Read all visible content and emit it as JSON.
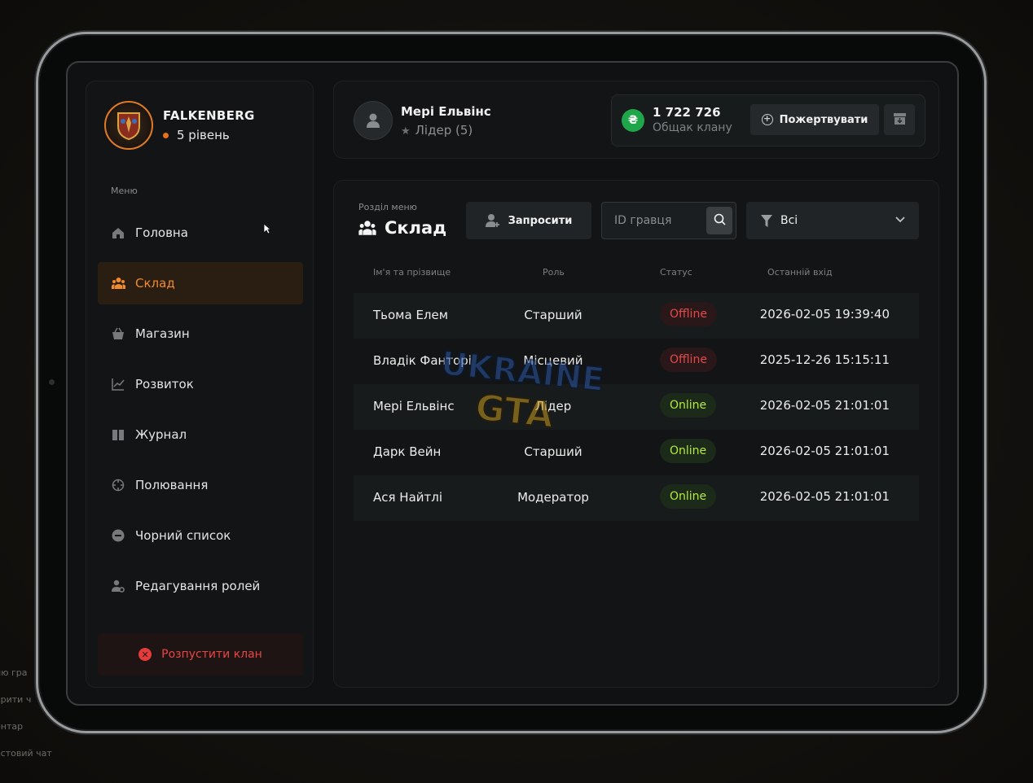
{
  "background": {
    "lines": [
      "ню гра",
      "крити ч",
      "ентар",
      "кстовий чат"
    ]
  },
  "clan": {
    "name": "FALKENBERG",
    "level": "5 рівень",
    "logo_icon": "clan-crest-icon"
  },
  "sidebar": {
    "menu_caption": "Меню",
    "items": [
      {
        "label": "Головна",
        "icon": "home-icon",
        "active": false
      },
      {
        "label": "Склад",
        "icon": "people-icon",
        "active": true
      },
      {
        "label": "Магазин",
        "icon": "basket-icon",
        "active": false
      },
      {
        "label": "Розвиток",
        "icon": "chart-icon",
        "active": false
      },
      {
        "label": "Журнал",
        "icon": "book-icon",
        "active": false
      },
      {
        "label": "Полювання",
        "icon": "crosshair-icon",
        "active": false
      },
      {
        "label": "Чорний список",
        "icon": "minus-circle-icon",
        "active": false
      },
      {
        "label": "Редагування ролей",
        "icon": "user-gear-icon",
        "active": false
      }
    ],
    "disband_label": "Розпустити клан"
  },
  "header": {
    "user_name": "Мері Ельвінс",
    "user_role": "Лідер (5)",
    "balance_amount": "1 722 726",
    "balance_label": "Общак клану",
    "coin_symbol": "₴",
    "donate_label": "Пожертвувати"
  },
  "main": {
    "section_caption": "Розділ меню",
    "section_title": "Склад",
    "invite_label": "Запросити",
    "search_placeholder": "ID гравця",
    "filter_value": "Всі",
    "columns": [
      "Ім'я та прізвище",
      "Роль",
      "Статус",
      "Останній вхід"
    ],
    "rows": [
      {
        "name": "Тьома Елем",
        "role": "Старший",
        "status": "Offline",
        "last_login": "2026-02-05 19:39:40"
      },
      {
        "name": "Владік Фанторі",
        "role": "Місцевий",
        "status": "Offline",
        "last_login": "2025-12-26 15:15:11"
      },
      {
        "name": "Мері Ельвінс",
        "role": "Лідер",
        "status": "Online",
        "last_login": "2026-02-05 21:01:01"
      },
      {
        "name": "Дарк Вейн",
        "role": "Старший",
        "status": "Online",
        "last_login": "2026-02-05 21:01:01"
      },
      {
        "name": "Ася Найтлі",
        "role": "Модератор",
        "status": "Online",
        "last_login": "2026-02-05 21:01:01"
      }
    ]
  },
  "watermark": {
    "line1": "UKRAINE",
    "line2": "GTA"
  },
  "colors": {
    "accent": "#f08a2f",
    "danger": "#e84545",
    "online": "#b6ea3a",
    "offline": "#e24a4a",
    "coin": "#1fa64a"
  }
}
